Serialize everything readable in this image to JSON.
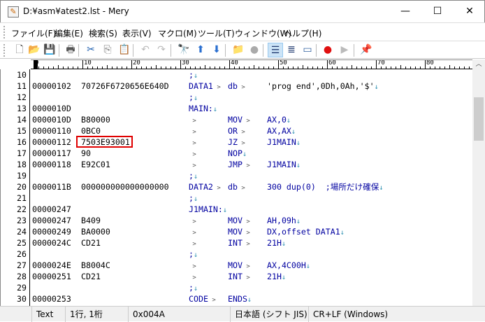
{
  "window": {
    "title": "D:¥asm¥atest2.lst - Mery",
    "minimize": "—",
    "maximize": "☐",
    "close": "✕"
  },
  "menu": [
    "ファイル(F)",
    "編集(E)",
    "検索(S)",
    "表示(V)",
    "マクロ(M)",
    "ツール(T)",
    "ウィンドウ(W)",
    "ヘルプ(H)"
  ],
  "toolbar": [
    {
      "name": "new-file",
      "glyph": "🗋"
    },
    {
      "name": "open-folder",
      "glyph": "📂"
    },
    {
      "name": "save",
      "glyph": "💾"
    },
    {
      "name": "print",
      "glyph": "🖶"
    },
    {
      "name": "cut",
      "glyph": "✂"
    },
    {
      "name": "copy",
      "glyph": "⎘"
    },
    {
      "name": "paste",
      "glyph": "📋"
    },
    {
      "name": "undo",
      "glyph": "↶"
    },
    {
      "name": "redo",
      "glyph": "↷"
    },
    {
      "name": "find",
      "glyph": "🔭"
    },
    {
      "name": "find-prev",
      "glyph": "⬆"
    },
    {
      "name": "find-next",
      "glyph": "⬇"
    },
    {
      "name": "grep",
      "glyph": "📁"
    },
    {
      "name": "globe",
      "glyph": "●"
    },
    {
      "name": "no-wrap",
      "glyph": "☰"
    },
    {
      "name": "wrap-window",
      "glyph": "≣"
    },
    {
      "name": "wrap-ruler",
      "glyph": "▭"
    },
    {
      "name": "record-macro",
      "glyph": "●"
    },
    {
      "name": "play-macro",
      "glyph": "▶"
    },
    {
      "name": "pin",
      "glyph": "📌"
    }
  ],
  "ruler": {
    "labels": [
      "0",
      "10",
      "20",
      "30",
      "40",
      "50",
      "60",
      "70",
      "80"
    ]
  },
  "lines": [
    {
      "n": "10",
      "addr": "",
      "code": "",
      "label": ";",
      "mnem": "",
      "op": ""
    },
    {
      "n": "11",
      "addr": "00000102",
      "code": "70726F6720656E640D",
      "label": "DATA1",
      "mnem": "db",
      "op": "'prog end',0Dh,0Ah,'$'"
    },
    {
      "n": "12",
      "addr": "",
      "code": "",
      "label": ";",
      "mnem": "",
      "op": ""
    },
    {
      "n": "13",
      "addr": "0000010D",
      "code": "",
      "label": "MAIN:",
      "mnem": "",
      "op": ""
    },
    {
      "n": "14",
      "addr": "0000010D",
      "code": "B80000",
      "label": "",
      "mnem": "MOV",
      "op": "AX,0"
    },
    {
      "n": "15",
      "addr": "00000110",
      "code": "0BC0",
      "label": "",
      "mnem": "OR",
      "op": "AX,AX"
    },
    {
      "n": "16",
      "addr": "00000112",
      "code": "7503E93001",
      "label": "",
      "mnem": "JZ",
      "op": "J1MAIN"
    },
    {
      "n": "17",
      "addr": "00000117",
      "code": "90",
      "label": "",
      "mnem": "NOP",
      "op": ""
    },
    {
      "n": "18",
      "addr": "00000118",
      "code": "E92C01",
      "label": "",
      "mnem": "JMP",
      "op": "J1MAIN"
    },
    {
      "n": "19",
      "addr": "",
      "code": "",
      "label": ";",
      "mnem": "",
      "op": ""
    },
    {
      "n": "20",
      "addr": "0000011B",
      "code": "000000000000000000",
      "label": "DATA2",
      "mnem": "db",
      "op": "300 dup(0)  ;場所だけ確保"
    },
    {
      "n": "21",
      "addr": "",
      "code": "",
      "label": ";",
      "mnem": "",
      "op": ""
    },
    {
      "n": "22",
      "addr": "00000247",
      "code": "",
      "label": "J1MAIN:",
      "mnem": "",
      "op": ""
    },
    {
      "n": "23",
      "addr": "00000247",
      "code": "B409",
      "label": "",
      "mnem": "MOV",
      "op": "AH,09h"
    },
    {
      "n": "24",
      "addr": "00000249",
      "code": "BA0000",
      "label": "",
      "mnem": "MOV",
      "op": "DX,offset DATA1"
    },
    {
      "n": "25",
      "addr": "0000024C",
      "code": "CD21",
      "label": "",
      "mnem": "INT",
      "op": "21H"
    },
    {
      "n": "26",
      "addr": "",
      "code": "",
      "label": ";",
      "mnem": "",
      "op": ""
    },
    {
      "n": "27",
      "addr": "0000024E",
      "code": "B8004C",
      "label": "",
      "mnem": "MOV",
      "op": "AX,4C00H"
    },
    {
      "n": "28",
      "addr": "00000251",
      "code": "CD21",
      "label": "",
      "mnem": "INT",
      "op": "21H"
    },
    {
      "n": "29",
      "addr": "",
      "code": "",
      "label": ";",
      "mnem": "",
      "op": ""
    },
    {
      "n": "30",
      "addr": "00000253",
      "code": "",
      "label": "CODE",
      "mnem": "ENDS",
      "op": ""
    }
  ],
  "status": {
    "mode": "Text",
    "position": "1行, 1桁",
    "code": "0x004A",
    "encoding": "日本語 (シフト JIS)",
    "newline": "CR+LF (Windows)"
  },
  "colors": {
    "keyword": "#0000a0",
    "highlight": "#e00000",
    "eol": "#2a8fb0"
  }
}
